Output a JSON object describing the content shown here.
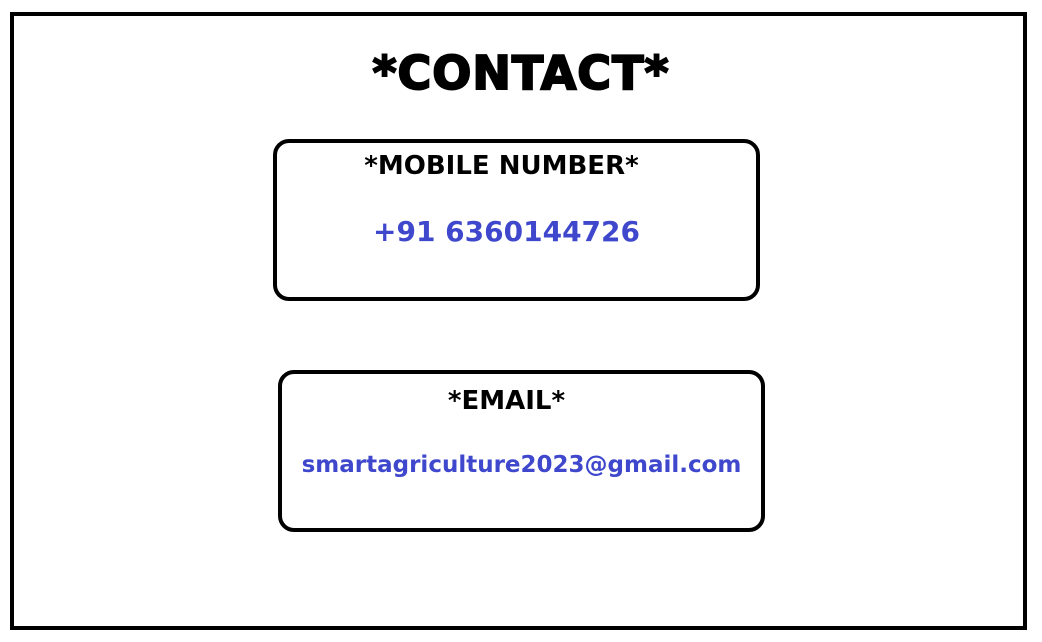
{
  "title": "*CONTACT*",
  "accent_color": "#3f48cc",
  "mobile": {
    "label": "*MOBILE NUMBER*",
    "value": "+91 6360144726"
  },
  "email": {
    "label": "*EMAIL*",
    "value": "smartagriculture2023@gmail.com"
  }
}
